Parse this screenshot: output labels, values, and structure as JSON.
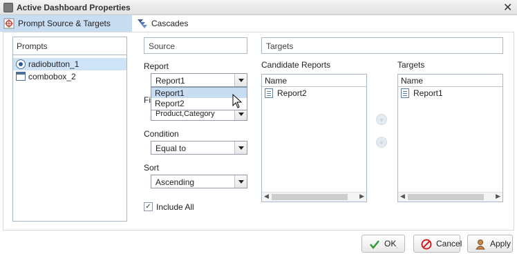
{
  "window": {
    "title": "Active Dashboard Properties"
  },
  "tabs": [
    {
      "label": "Prompt Source & Targets",
      "active": true
    },
    {
      "label": "Cascades",
      "active": false
    }
  ],
  "prompts": {
    "header": "Prompts",
    "items": [
      {
        "label": "radiobutton_1",
        "icon": "radio-button-icon",
        "selected": true
      },
      {
        "label": "combobox_2",
        "icon": "combobox-icon",
        "selected": false
      }
    ]
  },
  "source": {
    "header": "Source",
    "report_label": "Report",
    "report_value": "Report1",
    "report_options": [
      "Report1",
      "Report2"
    ],
    "field_label": "Fi",
    "field_value": "Product,Category",
    "condition_label": "Condition",
    "condition_value": "Equal to",
    "sort_label": "Sort",
    "sort_value": "Ascending",
    "include_all_label": "Include All",
    "include_all_checked": true
  },
  "targets": {
    "header": "Targets",
    "candidate_label": "Candidate Reports",
    "candidate_column": "Name",
    "candidate_items": [
      "Report2"
    ],
    "targets_label": "Targets",
    "targets_column": "Name",
    "targets_items": [
      "Report1"
    ],
    "add_icon": "double-chevron-right-icon",
    "remove_icon": "double-chevron-left-icon"
  },
  "buttons": {
    "ok": "OK",
    "cancel": "Cancel",
    "apply": "Apply"
  },
  "colors": {
    "tab_active": "#c8dcf2",
    "selection": "#cfe3f7",
    "ok_check": "#2e9b2e",
    "cancel_icon": "#cc2222"
  }
}
